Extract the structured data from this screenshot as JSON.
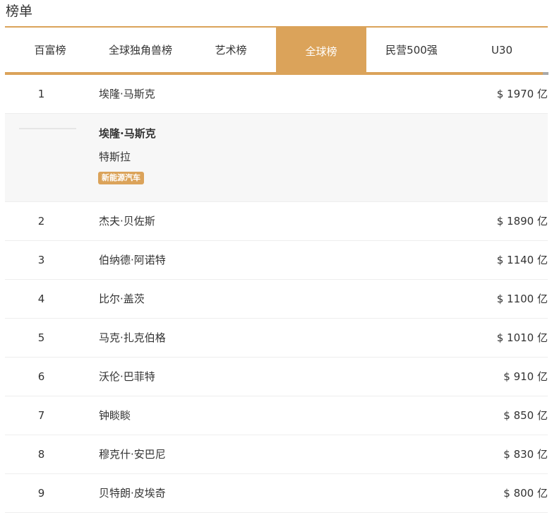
{
  "page": {
    "title": "榜单"
  },
  "tabs": [
    {
      "label": "百富榜",
      "active": false
    },
    {
      "label": "全球独角兽榜",
      "active": false
    },
    {
      "label": "艺术榜",
      "active": false
    },
    {
      "label": "全球榜",
      "active": true
    },
    {
      "label": "民营500强",
      "active": false
    },
    {
      "label": "U30",
      "active": false
    }
  ],
  "colors": {
    "accent": "#dba35a",
    "detail_bg": "#f7f7f7",
    "divider": "#eeeeee"
  },
  "expanded": {
    "name": "埃隆·马斯克",
    "company": "特斯拉",
    "tag": "新能源汽车"
  },
  "rows": [
    {
      "rank": "1",
      "name": "埃隆·马斯克",
      "worth": "$ 1970 亿"
    },
    {
      "rank": "2",
      "name": "杰夫·贝佐斯",
      "worth": "$ 1890 亿"
    },
    {
      "rank": "3",
      "name": "伯纳德·阿诺特",
      "worth": "$ 1140 亿"
    },
    {
      "rank": "4",
      "name": "比尔·盖茨",
      "worth": "$ 1100 亿"
    },
    {
      "rank": "5",
      "name": "马克·扎克伯格",
      "worth": "$ 1010 亿"
    },
    {
      "rank": "6",
      "name": "沃伦·巴菲特",
      "worth": "$ 910 亿"
    },
    {
      "rank": "7",
      "name": "钟睒睒",
      "worth": "$ 850 亿"
    },
    {
      "rank": "8",
      "name": "穆克什·安巴尼",
      "worth": "$ 830 亿"
    },
    {
      "rank": "9",
      "name": "贝特朗·皮埃奇",
      "worth": "$ 800 亿"
    }
  ]
}
